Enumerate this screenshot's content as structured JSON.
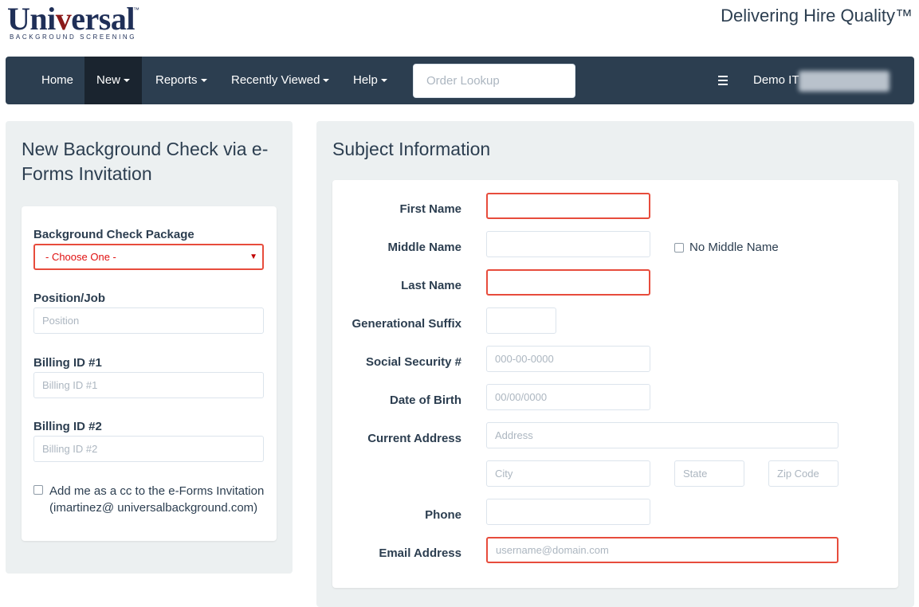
{
  "brand": {
    "logo_main": "Universal",
    "logo_tm": "™",
    "logo_sub": "BACKGROUND SCREENING",
    "tagline": "Delivering Hire Quality™"
  },
  "nav": {
    "items": [
      {
        "label": "Home",
        "dropdown": false
      },
      {
        "label": "New",
        "dropdown": true,
        "active": true
      },
      {
        "label": "Reports",
        "dropdown": true
      },
      {
        "label": "Recently Viewed",
        "dropdown": true
      },
      {
        "label": "Help",
        "dropdown": true
      }
    ],
    "search_placeholder": "Order Lookup",
    "user_name": "Demo IT"
  },
  "left_panel": {
    "title": "New Background Check via e-Forms Invitation",
    "package_label": "Background Check Package",
    "package_selected": "- Choose One -",
    "position_label": "Position/Job",
    "position_placeholder": "Position",
    "billing1_label": "Billing ID #1",
    "billing1_placeholder": "Billing ID #1",
    "billing2_label": "Billing ID #2",
    "billing2_placeholder": "Billing ID #2",
    "cc_label_line1": "Add me as a cc to the e-Forms Invitation",
    "cc_label_line2": "(imartinez@ universalbackground.com)",
    "cc_checked": false
  },
  "subject": {
    "title": "Subject Information",
    "first_name_label": "First Name",
    "middle_name_label": "Middle Name",
    "no_middle_name_label": "No Middle Name",
    "no_middle_name_checked": false,
    "last_name_label": "Last Name",
    "suffix_label": "Generational Suffix",
    "ssn_label": "Social Security #",
    "ssn_placeholder": "000-00-0000",
    "dob_label": "Date of Birth",
    "dob_placeholder": "00/00/0000",
    "address_label": "Current Address",
    "address_placeholder": "Address",
    "city_placeholder": "City",
    "state_placeholder": "State",
    "zip_placeholder": "Zip Code",
    "phone_label": "Phone",
    "email_label": "Email Address",
    "email_placeholder": "username@domain.com"
  },
  "colors": {
    "navbar": "#2c3e50",
    "navbar_active": "#1a242f",
    "panel_bg": "#ecf0f1",
    "error": "#e74c3c",
    "logo_navy": "#1f2f57",
    "logo_red": "#8b1a1a"
  },
  "icons": {
    "menu": "hamburger-icon",
    "dropdown": "caret-down-icon"
  }
}
